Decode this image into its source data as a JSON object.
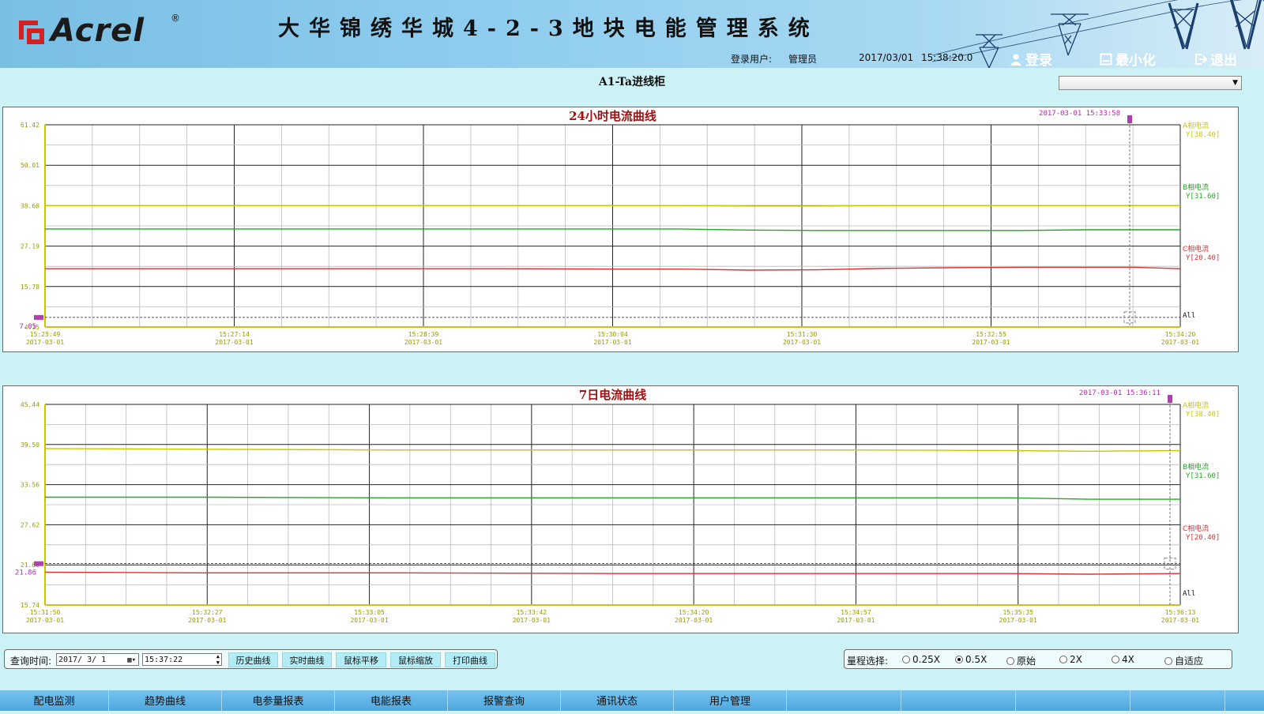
{
  "header": {
    "logo_text": "Acrel",
    "logo_reg": "®",
    "system_title": "大华锦绣华城4-2-3地块电能管理系统",
    "login_user_label": "登录用户:",
    "login_user": "管理员",
    "date": "2017/03/01",
    "time": "15:38:20.0",
    "buttons": {
      "login": "登录",
      "minimize": "最小化",
      "exit": "退出"
    },
    "icons": {
      "login": "user-icon",
      "minimize": "minimize-icon",
      "exit": "exit-icon"
    }
  },
  "device": {
    "title": "A1-Ta进线柜",
    "select_value": ""
  },
  "chart_data": [
    {
      "type": "line",
      "title": "24小时电流曲线",
      "ylim": [
        4.35,
        61.42
      ],
      "yticks": [
        "61.42",
        "50.01",
        "38.60",
        "27.19",
        "15.78",
        "4.35"
      ],
      "cursor_value": "7.05",
      "cursor_time": "2017-03-01 15:33:58",
      "xticks": [
        {
          "time": "15:25:49",
          "date": "2017-03-01"
        },
        {
          "time": "15:27:14",
          "date": "2017-03-01"
        },
        {
          "time": "15:28:39",
          "date": "2017-03-01"
        },
        {
          "time": "15:30:04",
          "date": "2017-03-01"
        },
        {
          "time": "15:31:30",
          "date": "2017-03-01"
        },
        {
          "time": "15:32:55",
          "date": "2017-03-01"
        },
        {
          "time": "15:34:20",
          "date": "2017-03-01"
        }
      ],
      "x": [
        0,
        0.1,
        0.2,
        0.3,
        0.4,
        0.5,
        0.56,
        0.62,
        0.68,
        0.74,
        0.8,
        0.86,
        0.92,
        0.96,
        1.0
      ],
      "series": [
        {
          "name": "A相电流",
          "value_label": "Y[38.40]",
          "color": "#c8c800",
          "values": [
            38.6,
            38.6,
            38.6,
            38.6,
            38.6,
            38.6,
            38.6,
            38.5,
            38.5,
            38.6,
            38.6,
            38.6,
            38.6,
            38.6,
            38.6
          ]
        },
        {
          "name": "B相电流",
          "value_label": "Y[31.60]",
          "color": "#22aa22",
          "values": [
            32.0,
            32.0,
            32.0,
            32.0,
            32.0,
            32.0,
            32.0,
            31.7,
            31.6,
            31.6,
            31.6,
            31.6,
            31.8,
            31.8,
            31.8
          ]
        },
        {
          "name": "C相电流",
          "value_label": "Y[20.40]",
          "color": "#dd3333",
          "values": [
            20.8,
            20.8,
            20.8,
            20.8,
            20.8,
            20.7,
            20.7,
            20.4,
            20.5,
            20.9,
            21.1,
            21.2,
            21.2,
            21.2,
            20.8
          ]
        }
      ],
      "all_label": "All"
    },
    {
      "type": "line",
      "title": "7日电流曲线",
      "ylim": [
        15.74,
        45.44
      ],
      "yticks": [
        "45.44",
        "39.50",
        "33.56",
        "27.62",
        "21.68",
        "15.74"
      ],
      "cursor_value": "21.86",
      "cursor_time": "2017-03-01 15:36:11",
      "xticks": [
        {
          "time": "15:31:50",
          "date": "2017-03-01"
        },
        {
          "time": "15:32:27",
          "date": "2017-03-01"
        },
        {
          "time": "15:33:05",
          "date": "2017-03-01"
        },
        {
          "time": "15:33:42",
          "date": "2017-03-01"
        },
        {
          "time": "15:34:20",
          "date": "2017-03-01"
        },
        {
          "time": "15:34:57",
          "date": "2017-03-01"
        },
        {
          "time": "15:35:35",
          "date": "2017-03-01"
        },
        {
          "time": "15:36:13",
          "date": "2017-03-01"
        }
      ],
      "x": [
        0,
        0.14,
        0.3,
        0.5,
        0.7,
        0.85,
        0.92,
        1.0
      ],
      "series": [
        {
          "name": "A相电流",
          "value_label": "Y[38.40]",
          "color": "#c8c800",
          "values": [
            38.9,
            38.8,
            38.7,
            38.7,
            38.7,
            38.6,
            38.5,
            38.6
          ]
        },
        {
          "name": "B相电流",
          "value_label": "Y[31.60]",
          "color": "#22aa22",
          "values": [
            31.7,
            31.7,
            31.6,
            31.6,
            31.6,
            31.6,
            31.4,
            31.4
          ]
        },
        {
          "name": "C相电流",
          "value_label": "Y[20.40]",
          "color": "#dd3333",
          "values": [
            20.6,
            20.5,
            20.5,
            20.4,
            20.4,
            20.4,
            20.3,
            20.4
          ]
        }
      ],
      "all_label": "All"
    }
  ],
  "toolbar": {
    "query_label": "查询时间:",
    "date_value": "2017/ 3/ 1",
    "time_value": "15:37:22",
    "buttons": [
      "历史曲线",
      "实时曲线",
      "鼠标平移",
      "鼠标缩放",
      "打印曲线"
    ]
  },
  "range": {
    "label": "量程选择:",
    "options": [
      "0.25X",
      "0.5X",
      "原始",
      "2X",
      "4X",
      "自适应"
    ],
    "selected": "0.5X"
  },
  "nav": [
    "配电监测",
    "趋势曲线",
    "电参量报表",
    "电能报表",
    "报警查询",
    "通讯状态",
    "用户管理"
  ]
}
